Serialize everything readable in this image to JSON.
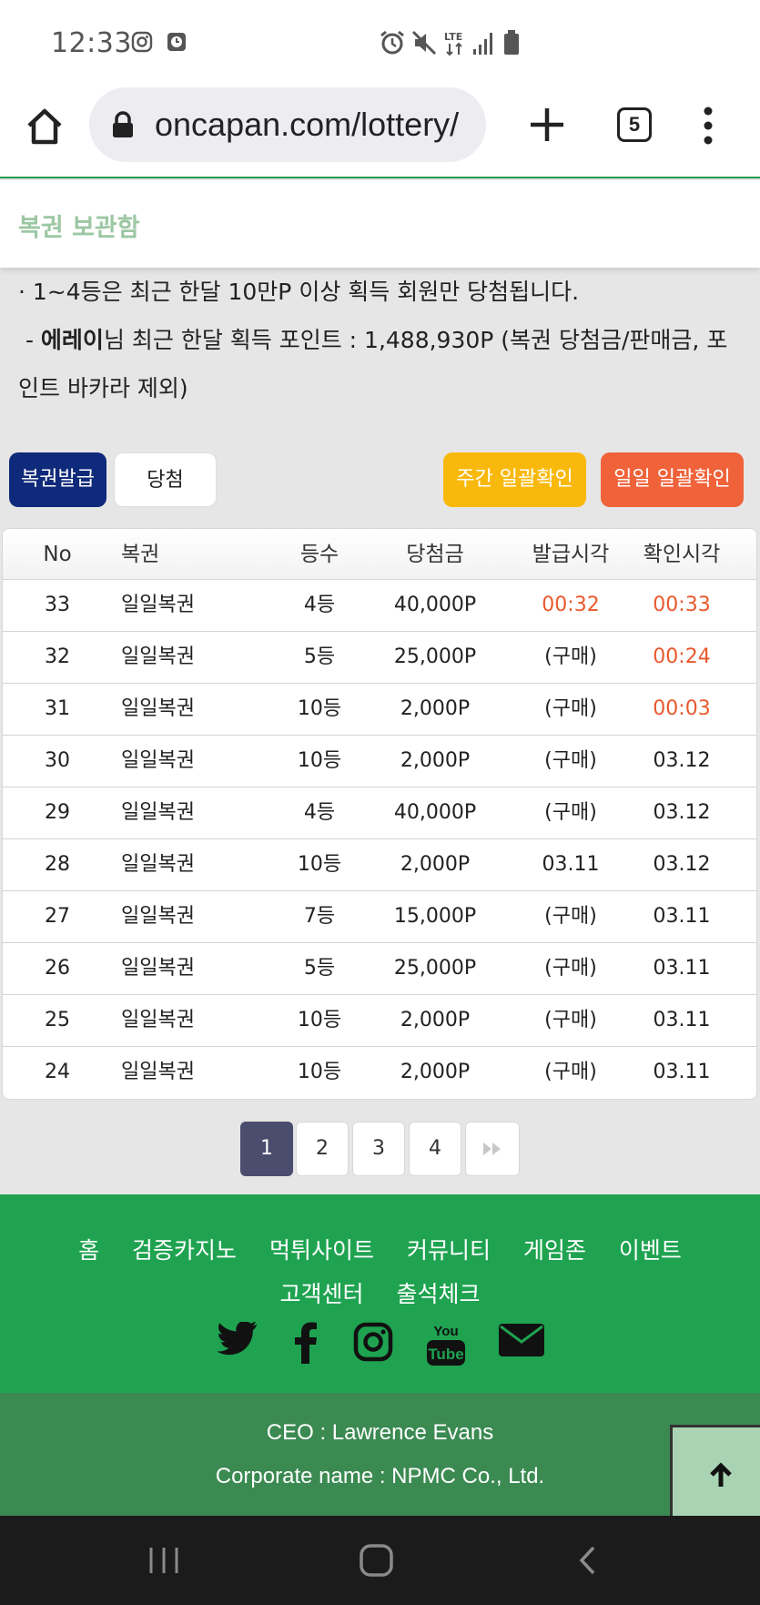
{
  "status_bar": {
    "time": "12:33",
    "network": "LTE"
  },
  "browser": {
    "url": "oncapan.com/lottery/",
    "tab_count": "5"
  },
  "header": {
    "title": "복권 보관함"
  },
  "notice": {
    "line1": "· 1~4등은 최근 한달 10만P 이상 획득 회원만 당첨됩니다.",
    "user_name": "에레이",
    "line2_rest": "님 최근 한달 획득 포인트 : 1,488,930P (복권 당첨금/판매금, 포",
    "line3": "인트 바카라 제외)"
  },
  "buttons": {
    "issue": "복권발급",
    "win": "당첨",
    "weekly_check": "주간 일괄확인",
    "daily_check": "일일 일괄확인"
  },
  "table": {
    "headers": {
      "no": "No",
      "name": "복권",
      "rank": "등수",
      "prize": "당첨금",
      "issued": "발급시각",
      "checked": "확인시각"
    },
    "rows": [
      {
        "no": "33",
        "name": "일일복권",
        "rank": "4등",
        "prize": "40,000P",
        "issued": "00:32",
        "checked": "00:33"
      },
      {
        "no": "32",
        "name": "일일복권",
        "rank": "5등",
        "prize": "25,000P",
        "issued": "(구매)",
        "checked": "00:24"
      },
      {
        "no": "31",
        "name": "일일복권",
        "rank": "10등",
        "prize": "2,000P",
        "issued": "(구매)",
        "checked": "00:03"
      },
      {
        "no": "30",
        "name": "일일복권",
        "rank": "10등",
        "prize": "2,000P",
        "issued": "(구매)",
        "checked": "03.12"
      },
      {
        "no": "29",
        "name": "일일복권",
        "rank": "4등",
        "prize": "40,000P",
        "issued": "(구매)",
        "checked": "03.12"
      },
      {
        "no": "28",
        "name": "일일복권",
        "rank": "10등",
        "prize": "2,000P",
        "issued": "03.11",
        "checked": "03.12"
      },
      {
        "no": "27",
        "name": "일일복권",
        "rank": "7등",
        "prize": "15,000P",
        "issued": "(구매)",
        "checked": "03.11"
      },
      {
        "no": "26",
        "name": "일일복권",
        "rank": "5등",
        "prize": "25,000P",
        "issued": "(구매)",
        "checked": "03.11"
      },
      {
        "no": "25",
        "name": "일일복권",
        "rank": "10등",
        "prize": "2,000P",
        "issued": "(구매)",
        "checked": "03.11"
      },
      {
        "no": "24",
        "name": "일일복권",
        "rank": "10등",
        "prize": "2,000P",
        "issued": "(구매)",
        "checked": "03.11"
      }
    ]
  },
  "pagination": {
    "pages": [
      "1",
      "2",
      "3",
      "4"
    ],
    "current": "1"
  },
  "footer": {
    "nav_row1": [
      "홈",
      "검증카지노",
      "먹튀사이트",
      "커뮤니티",
      "게임존",
      "이벤트"
    ],
    "nav_row2": [
      "고객센터",
      "출석체크"
    ],
    "social_icons": [
      "twitter-icon",
      "facebook-icon",
      "instagram-icon",
      "youtube-icon",
      "mail-icon"
    ],
    "ceo": "CEO : Lawrence Evans",
    "corporate": "Corporate name : NPMC Co., Ltd."
  },
  "colors": {
    "header_title": "#9cc7a3",
    "issue_button": "#0f2a7a",
    "weekly_button": "#f9b90c",
    "daily_button": "#f0623a",
    "today_time": "#e8592d",
    "footer_green": "#1fa351",
    "footer_dark_green": "#3b8a52",
    "pager_active": "#4a4d6e"
  }
}
